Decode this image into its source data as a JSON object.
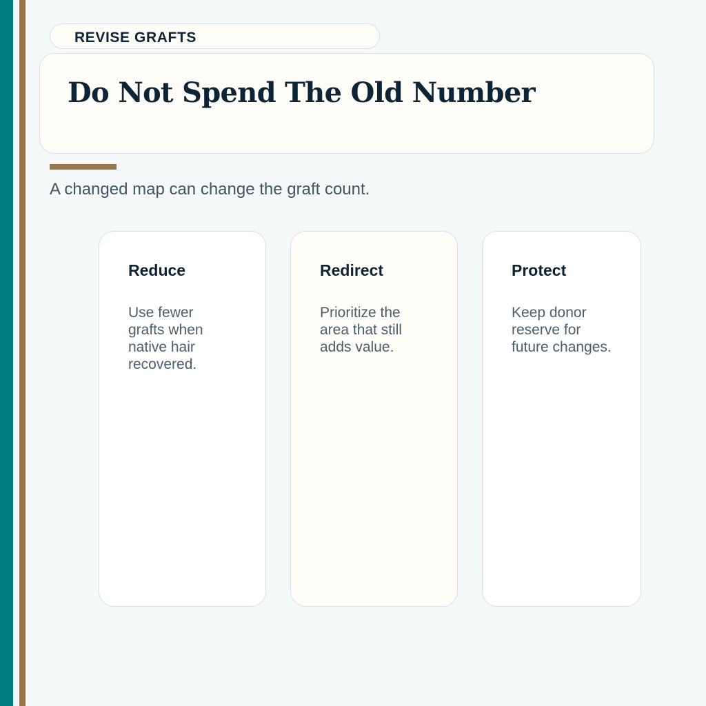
{
  "eyebrow": "REVISE GRAFTS",
  "title": "Do Not Spend The Old Number",
  "subtitle": "A changed map can change the graft count.",
  "cards": [
    {
      "title": "Reduce",
      "body": "Use fewer grafts when native hair recovered."
    },
    {
      "title": "Redirect",
      "body": "Prioritize the area that still adds value."
    },
    {
      "title": "Protect",
      "body": "Keep donor reserve for future changes."
    }
  ],
  "colors": {
    "teal_stripe": "#007b7f",
    "tan_accent": "#98754c",
    "navy_text": "#0d2436",
    "panel_cream": "#fffdf8",
    "background": "#f6f9fa"
  }
}
